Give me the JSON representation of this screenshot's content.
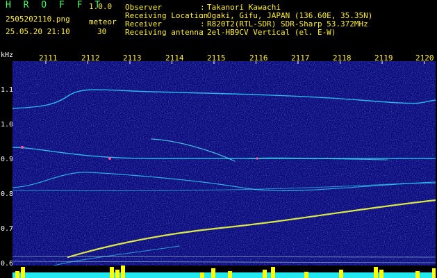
{
  "app": {
    "name": "H R O F F T",
    "version": "1.0.0"
  },
  "file": {
    "name": "2505202110.png",
    "datetime": "25.05.20 21:10"
  },
  "meteor": {
    "label": "meteor",
    "count": "30"
  },
  "info": [
    {
      "key": "Observer",
      "sep": ":",
      "value": "Takanori Kawachi"
    },
    {
      "key": "Receiving Location",
      "sep": ":",
      "value": "Ogaki, Gifu, JAPAN (136.60E, 35.35N)"
    },
    {
      "key": "Receiver",
      "sep": ":",
      "value": "R820T2(RTL-SDR) SDR-Sharp 53.372MHz"
    },
    {
      "key": "Receiving antenna",
      "sep": ":",
      "value": "2el-HB9CV Vertical (el. E-W)"
    }
  ],
  "axis": {
    "y_unit": "kHz",
    "y_ticks": [
      "1.1",
      "1.0",
      "0.9",
      "0.8",
      "0.7",
      "0.6"
    ],
    "x_ticks": [
      "2111",
      "2112",
      "2113",
      "2114",
      "2115",
      "2116",
      "2117",
      "2118",
      "2119",
      "2120"
    ]
  },
  "colors": {
    "background": "#000000",
    "spectrogram_bg": "#0a0a78",
    "header_green": "#3dff5a",
    "header_yellow": "#ffee33",
    "trace_cyan": "#33ddff",
    "trace_yellow": "#f0ff40",
    "bottom_bar_cyan": "#22e8f0",
    "bottom_peaks_yellow": "#ffff00"
  }
}
